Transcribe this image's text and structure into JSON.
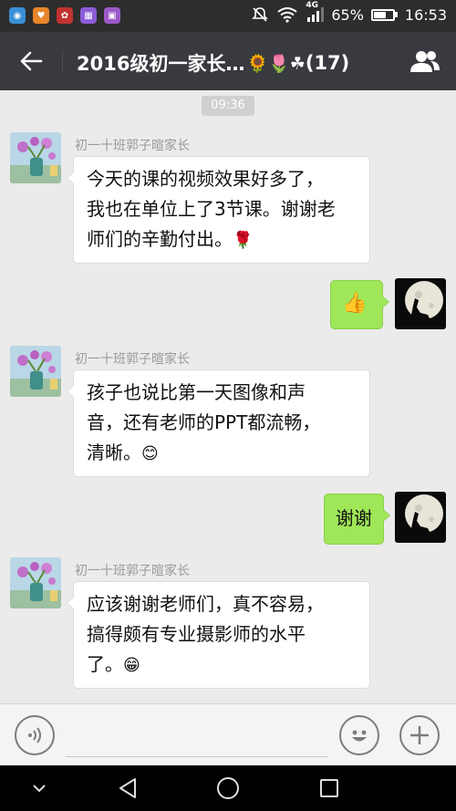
{
  "status_bar": {
    "battery_percent": "65%",
    "battery_level": 0.65,
    "network": "4G",
    "time": "16:53",
    "icons": [
      "mute-icon",
      "wifi-icon",
      "signal-icon",
      "battery-icon"
    ]
  },
  "header": {
    "title": "2016级初一家长…",
    "title_emojis": "🌻🌷☘",
    "member_count": "(17)",
    "back_icon": "back-arrow-icon",
    "group_icon": "group-members-icon"
  },
  "chat": {
    "time_chip": "09:36",
    "messages": [
      {
        "direction": "incoming",
        "sender": "初一十班郭子暄家长",
        "lines": [
          "今天的课的视频效果好多了，",
          "我也在单位上了3节课。谢谢老",
          "师们的辛勤付出。"
        ],
        "emoji": "🌹"
      },
      {
        "direction": "outgoing",
        "emoji": "👍"
      },
      {
        "direction": "incoming",
        "sender": "初一十班郭子暄家长",
        "lines": [
          "孩子也说比第一天图像和声",
          "音，还有老师的PPT都流畅，",
          "清晰。"
        ],
        "emoji": "😊"
      },
      {
        "direction": "outgoing",
        "text": "谢谢"
      },
      {
        "direction": "incoming",
        "sender": "初一十班郭子暄家长",
        "lines": [
          "应该谢谢老师们，真不容易，",
          "搞得颇有专业摄影师的水平",
          "了。"
        ],
        "emoji": "😁"
      }
    ]
  },
  "input_bar": {
    "voice_icon": "voice-input-icon",
    "text_value": "",
    "emoji_icon": "emoji-icon",
    "plus_icon": "plus-icon"
  },
  "nav_bar": {
    "icons": [
      "collapse-icon",
      "back-triangle-icon",
      "home-circle-icon",
      "recents-square-icon"
    ]
  },
  "colors": {
    "status_bar": "#2d2d2d",
    "title_bar": "#393a3f",
    "chat_bg": "#ebebeb",
    "outgoing_bubble": "#9fe658",
    "incoming_bubble": "#ffffff"
  }
}
